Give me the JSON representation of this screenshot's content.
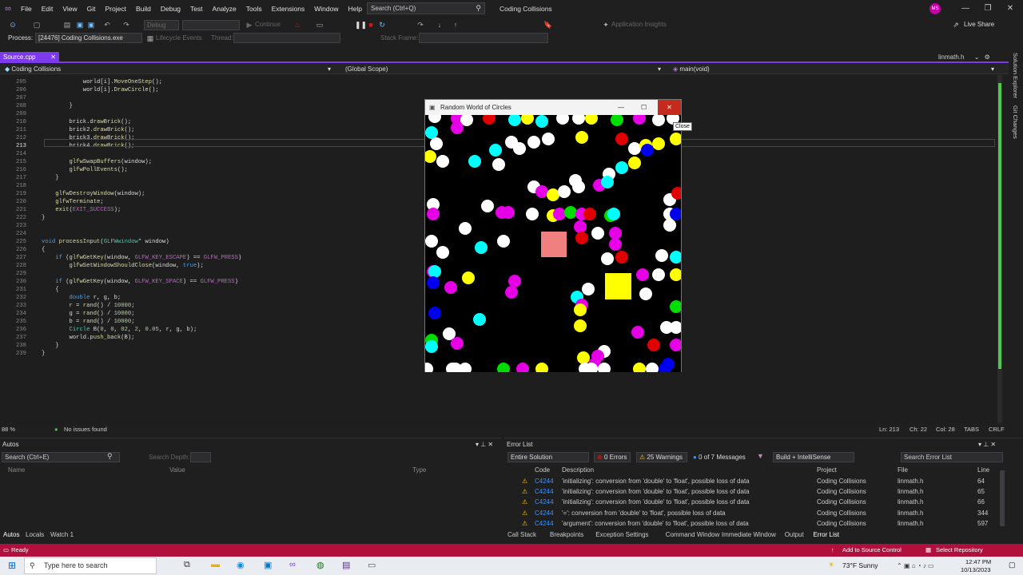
{
  "menu": [
    "File",
    "Edit",
    "View",
    "Git",
    "Project",
    "Build",
    "Debug",
    "Test",
    "Analyze",
    "Tools",
    "Extensions",
    "Window",
    "Help"
  ],
  "search": {
    "placeholder": "Search (Ctrl+Q)"
  },
  "app_title": "Coding Collisions",
  "user_initials": "MS",
  "toolbar": {
    "debug_combo": "Debug",
    "continue_label": "Continue",
    "app_insights": "Application Insights",
    "live_share": "Live Share"
  },
  "toolbar2": {
    "process_label": "Process:",
    "process_value": "[24476] Coding Collisions.exe",
    "lifecycle": "Lifecycle Events",
    "thread": "Thread:",
    "stack_frame": "Stack Frame:"
  },
  "tabs": {
    "active": "Source.cpp",
    "right": "linmath.h"
  },
  "nav": {
    "project": "Coding Collisions",
    "scope": "(Global Scope)",
    "member": "main(void)"
  },
  "code_lines": [
    {
      "n": "205",
      "t": "            world[i].MoveOneStep();"
    },
    {
      "n": "206",
      "t": "            world[i].DrawCircle();"
    },
    {
      "n": "207",
      "t": ""
    },
    {
      "n": "208",
      "t": "        }"
    },
    {
      "n": "209",
      "t": ""
    },
    {
      "n": "210",
      "t": "        brick.drawBrick();"
    },
    {
      "n": "211",
      "t": "        brick2.drawBrick();"
    },
    {
      "n": "212",
      "t": "        brick3.drawBrick();"
    },
    {
      "n": "213",
      "t": "        brick4.drawBrick();"
    },
    {
      "n": "214",
      "t": ""
    },
    {
      "n": "215",
      "t": "        glfwSwapBuffers(window);"
    },
    {
      "n": "216",
      "t": "        glfwPollEvents();"
    },
    {
      "n": "217",
      "t": "    }"
    },
    {
      "n": "218",
      "t": ""
    },
    {
      "n": "219",
      "t": "    glfwDestroyWindow(window);"
    },
    {
      "n": "220",
      "t": "    glfwTerminate;"
    },
    {
      "n": "221",
      "t": "    exit(EXIT_SUCCESS);"
    },
    {
      "n": "222",
      "t": "}"
    },
    {
      "n": "223",
      "t": ""
    },
    {
      "n": "224",
      "t": ""
    },
    {
      "n": "225",
      "t": "void processInput(GLFWwindow* window)"
    },
    {
      "n": "226",
      "t": "{"
    },
    {
      "n": "227",
      "t": "    if (glfwGetKey(window, GLFW_KEY_ESCAPE) == GLFW_PRESS)"
    },
    {
      "n": "228",
      "t": "        glfwSetWindowShouldClose(window, true);"
    },
    {
      "n": "229",
      "t": ""
    },
    {
      "n": "230",
      "t": "    if (glfwGetKey(window, GLFW_KEY_SPACE) == GLFW_PRESS)"
    },
    {
      "n": "231",
      "t": "    {"
    },
    {
      "n": "232",
      "t": "        double r, g, b;"
    },
    {
      "n": "233",
      "t": "        r = rand() / 10000;"
    },
    {
      "n": "234",
      "t": "        g = rand() / 10000;"
    },
    {
      "n": "235",
      "t": "        b = rand() / 10000;"
    },
    {
      "n": "236",
      "t": "        Circle B(0, 0, 02, 2, 0.05, r, g, b);"
    },
    {
      "n": "237",
      "t": "        world.push_back(B);"
    },
    {
      "n": "238",
      "t": "    }"
    },
    {
      "n": "239",
      "t": "}"
    }
  ],
  "editor_status": {
    "zoom": "88 %",
    "issues": "No issues found",
    "ln": "Ln: 213",
    "ch": "Ch: 22",
    "col": "Col: 28",
    "tabs": "TABS",
    "eol": "CRLF"
  },
  "game_window": {
    "title": "Random World of Circles",
    "tooltip": "Close"
  },
  "autos": {
    "title": "Autos",
    "search": "Search (Ctrl+E)",
    "depth": "Search Depth:",
    "cols": [
      "Name",
      "Value",
      "Type"
    ],
    "tabs": [
      "Autos",
      "Locals",
      "Watch 1"
    ]
  },
  "error_list": {
    "title": "Error List",
    "scope": "Entire Solution",
    "errors": "0 Errors",
    "warnings": "25 Warnings",
    "messages": "0 of 7 Messages",
    "build": "Build + IntelliSense",
    "search": "Search Error List",
    "cols": [
      "Code",
      "Description",
      "Project",
      "File",
      "Line"
    ],
    "rows": [
      {
        "code": "C4244",
        "desc": "'initializing': conversion from 'double' to 'float', possible loss of data",
        "project": "Coding Collisions",
        "file": "linmath.h",
        "line": "64"
      },
      {
        "code": "C4244",
        "desc": "'initializing': conversion from 'double' to 'float', possible loss of data",
        "project": "Coding Collisions",
        "file": "linmath.h",
        "line": "65"
      },
      {
        "code": "C4244",
        "desc": "'initializing': conversion from 'double' to 'float', possible loss of data",
        "project": "Coding Collisions",
        "file": "linmath.h",
        "line": "66"
      },
      {
        "code": "C4244",
        "desc": "'=': conversion from 'double' to 'float', possible loss of data",
        "project": "Coding Collisions",
        "file": "linmath.h",
        "line": "344"
      },
      {
        "code": "C4244",
        "desc": "'argument': conversion from 'double' to 'float', possible loss of data",
        "project": "Coding Collisions",
        "file": "linmath.h",
        "line": "597"
      }
    ],
    "bottom_tabs": [
      "Call Stack",
      "Breakpoints",
      "Exception Settings",
      "Command Window",
      "Immediate Window",
      "Output",
      "Error List"
    ]
  },
  "statusbar": {
    "ready": "Ready",
    "source_control": "Add to Source Control",
    "repo": "Select Repository"
  },
  "taskbar": {
    "search": "Type here to search",
    "weather": "73°F  Sunny",
    "time": "12:47 PM",
    "date": "10/13/2023"
  },
  "side_tabs": [
    "Solution Explorer",
    "Git Changes"
  ],
  "colors": {
    "accent": "#7c3aed",
    "status": "#b1103c",
    "close_btn": "#c42b1c"
  }
}
